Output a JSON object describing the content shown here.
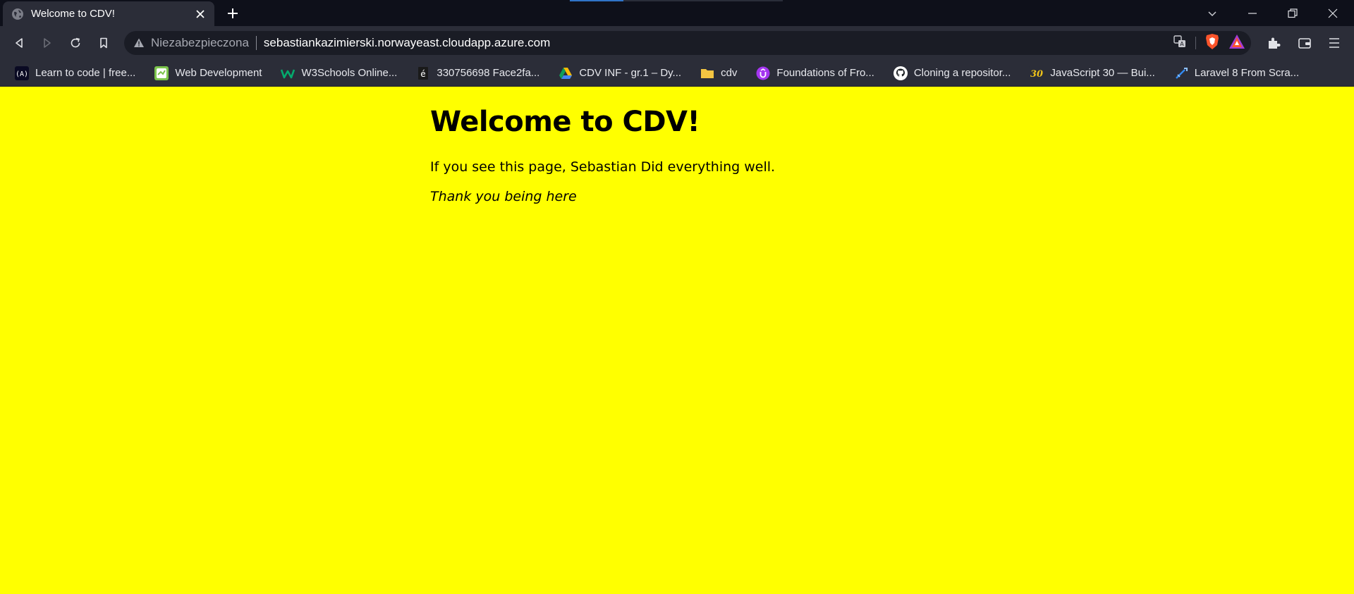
{
  "tab": {
    "title": "Welcome to CDV!",
    "favicon": "globe-icon"
  },
  "load_progress": 0.25,
  "toolbar": {
    "security_label": "Niezabezpieczona",
    "url": "sebastiankazimierski.norwayeast.cloudapp.azure.com"
  },
  "bookmarks": [
    {
      "label": "Learn to code | free...",
      "icon": "freecodecamp-icon"
    },
    {
      "label": "Web Development",
      "icon": "webdev-icon"
    },
    {
      "label": "W3Schools Online...",
      "icon": "w3schools-icon"
    },
    {
      "label": "330756698 Face2fa...",
      "icon": "document-icon"
    },
    {
      "label": "CDV INF - gr.1 – Dy...",
      "icon": "google-drive-icon"
    },
    {
      "label": "cdv",
      "icon": "folder-icon"
    },
    {
      "label": "Foundations of Fro...",
      "icon": "udemy-icon"
    },
    {
      "label": "Cloning a repositor...",
      "icon": "github-icon"
    },
    {
      "label": "JavaScript 30 — Bui...",
      "icon": "javascript30-icon"
    },
    {
      "label": "Laravel 8 From Scra...",
      "icon": "laracasts-icon"
    }
  ],
  "page": {
    "heading": "Welcome to CDV!",
    "line1": "If you see this page, Sebastian Did everything well.",
    "line2": "Thank you being here"
  },
  "colors": {
    "page_background": "#ffff00",
    "chrome_dark": "#0e101a",
    "toolbar": "#2b2d38",
    "brave_orange": "#fb542b"
  }
}
